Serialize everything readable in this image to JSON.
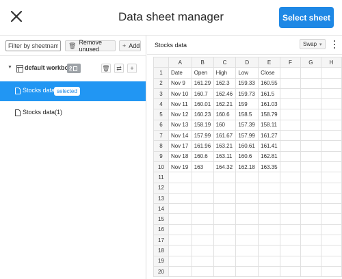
{
  "header": {
    "title": "Data sheet manager",
    "primary_button": "Select sheet"
  },
  "left_panel": {
    "filter_placeholder": "Filter by sheetname",
    "remove_unused_label": "Remove unused",
    "add_label": "Add",
    "workbook": {
      "label": "default workbook",
      "sheet_count": "2"
    },
    "sheets": [
      {
        "label": "Stocks data",
        "badge": "selected",
        "selected": true
      },
      {
        "label": "Stocks data(1)",
        "badge": "",
        "selected": false
      }
    ]
  },
  "right_panel": {
    "sheet_name": "Stocks data",
    "swap_label": "Swap",
    "columns": [
      "A",
      "B",
      "C",
      "D",
      "E",
      "F",
      "G",
      "H"
    ],
    "row_numbers": [
      "1",
      "2",
      "3",
      "4",
      "5",
      "6",
      "7",
      "8",
      "9",
      "10",
      "11",
      "12",
      "13",
      "14",
      "15",
      "16",
      "17",
      "18",
      "19",
      "20"
    ],
    "rows": [
      [
        "Date",
        "Open",
        "High",
        "Low",
        "Close",
        "",
        "",
        ""
      ],
      [
        "Nov 9",
        "161.29",
        "162.3",
        "159.33",
        "160.55",
        "",
        "",
        ""
      ],
      [
        "Nov 10",
        "160.7",
        "162.46",
        "159.73",
        "161.5",
        "",
        "",
        ""
      ],
      [
        "Nov 11",
        "160.01",
        "162.21",
        "159",
        "161.03",
        "",
        "",
        ""
      ],
      [
        "Nov 12",
        "160.23",
        "160.6",
        "158.5",
        "158.79",
        "",
        "",
        ""
      ],
      [
        "Nov 13",
        "158.19",
        "160",
        "157.39",
        "158.11",
        "",
        "",
        ""
      ],
      [
        "Nov 14",
        "157.99",
        "161.67",
        "157.99",
        "161.27",
        "",
        "",
        ""
      ],
      [
        "Nov 17",
        "161.96",
        "163.21",
        "160.61",
        "161.41",
        "",
        "",
        ""
      ],
      [
        "Nov 18",
        "160.6",
        "163.11",
        "160.6",
        "162.81",
        "",
        "",
        ""
      ],
      [
        "Nov 19",
        "163",
        "164.32",
        "162.18",
        "163.35",
        "",
        "",
        ""
      ],
      [
        "",
        "",
        "",
        "",
        "",
        "",
        "",
        ""
      ],
      [
        "",
        "",
        "",
        "",
        "",
        "",
        "",
        ""
      ],
      [
        "",
        "",
        "",
        "",
        "",
        "",
        "",
        ""
      ],
      [
        "",
        "",
        "",
        "",
        "",
        "",
        "",
        ""
      ],
      [
        "",
        "",
        "",
        "",
        "",
        "",
        "",
        ""
      ],
      [
        "",
        "",
        "",
        "",
        "",
        "",
        "",
        ""
      ],
      [
        "",
        "",
        "",
        "",
        "",
        "",
        "",
        ""
      ],
      [
        "",
        "",
        "",
        "",
        "",
        "",
        "",
        ""
      ],
      [
        "",
        "",
        "",
        "",
        "",
        "",
        "",
        ""
      ],
      [
        "",
        "",
        "",
        "",
        "",
        "",
        "",
        ""
      ]
    ]
  },
  "colors": {
    "accent": "#1e88e5",
    "selected_row": "#2196f3"
  }
}
